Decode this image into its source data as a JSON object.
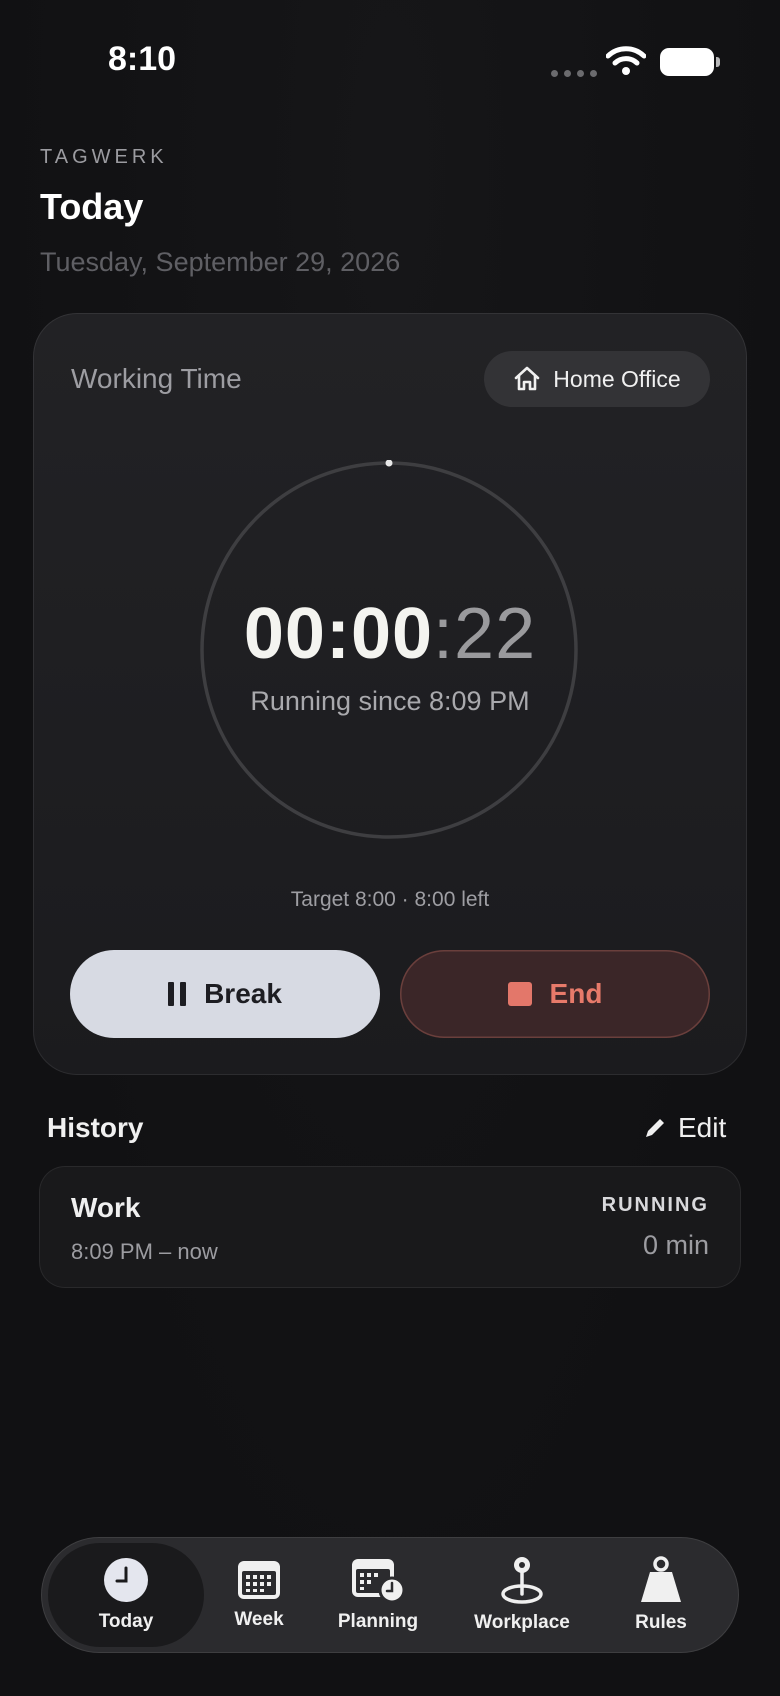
{
  "status_bar": {
    "time": "8:10"
  },
  "header": {
    "brand": "TAGWERK",
    "title": "Today",
    "date": "Tuesday, September 29, 2026"
  },
  "timer_card": {
    "label": "Working Time",
    "location": "Home Office",
    "time_main": "00:00",
    "time_seconds": ":22",
    "running_since": "Running since 8:09 PM",
    "target": "Target 8:00 · 8:00 left",
    "break_label": "Break",
    "end_label": "End"
  },
  "history": {
    "title": "History",
    "edit_label": "Edit",
    "items": [
      {
        "kind": "Work",
        "range": "8:09 PM – now",
        "status": "RUNNING",
        "duration": "0 min"
      }
    ]
  },
  "tabbar": {
    "items": [
      {
        "label": "Today",
        "icon": "clock-icon",
        "active": true
      },
      {
        "label": "Week",
        "icon": "calendar-icon"
      },
      {
        "label": "Planning",
        "icon": "calendar-clock-icon"
      },
      {
        "label": "Workplace",
        "icon": "location-pin-icon"
      },
      {
        "label": "Rules",
        "icon": "weight-icon"
      }
    ]
  },
  "colors": {
    "accent_end": "#e77a6a",
    "break_button": "#d7dae3",
    "background": "#121214"
  }
}
